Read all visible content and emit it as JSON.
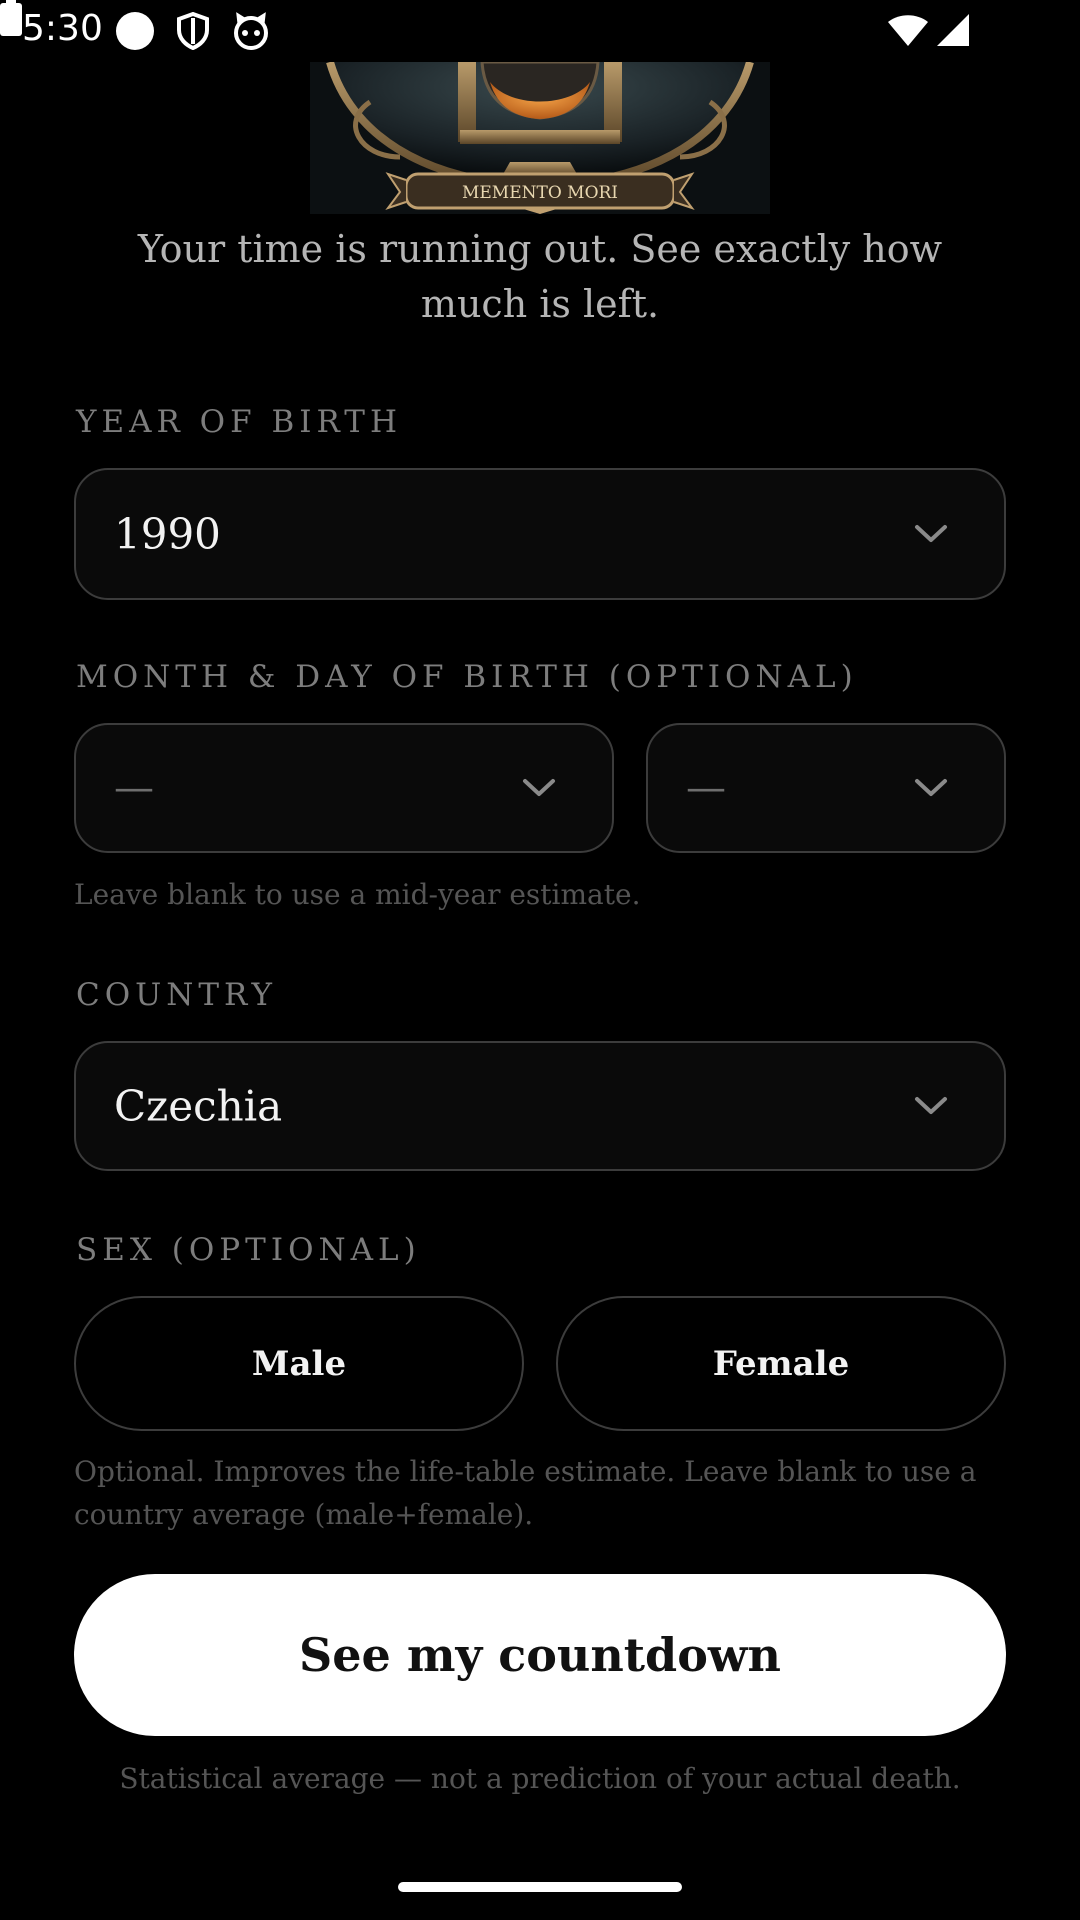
{
  "status_bar": {
    "time": "5:30",
    "icons": [
      "notification-dot-icon",
      "shield-icon",
      "cat-icon",
      "wifi-icon",
      "signal-icon",
      "battery-icon"
    ]
  },
  "hero": {
    "banner_text": "MEMENTO MORI",
    "icon": "hourglass-illustration"
  },
  "tagline": "Your time is running out. See exactly how much is left.",
  "year_of_birth": {
    "label": "YEAR OF BIRTH",
    "value": "1990"
  },
  "month_day": {
    "label": "MONTH & DAY OF BIRTH (OPTIONAL)",
    "month_value": "—",
    "day_value": "—",
    "hint": "Leave blank to use a mid-year estimate."
  },
  "country": {
    "label": "COUNTRY",
    "value": "Czechia"
  },
  "sex": {
    "label": "SEX (OPTIONAL)",
    "options": [
      "Male",
      "Female"
    ],
    "hint_line1": "Optional. Improves the life-table estimate. Leave blank to use a",
    "hint_line2": "country average (male+female)."
  },
  "cta_label": "See my countdown",
  "disclaimer": "Statistical average — not a prediction of your actual death.",
  "colors": {
    "background": "#000000",
    "field_border": "#3c3c3c",
    "cta_background": "#ffffff",
    "hourglass_sand": "#e8822a"
  }
}
